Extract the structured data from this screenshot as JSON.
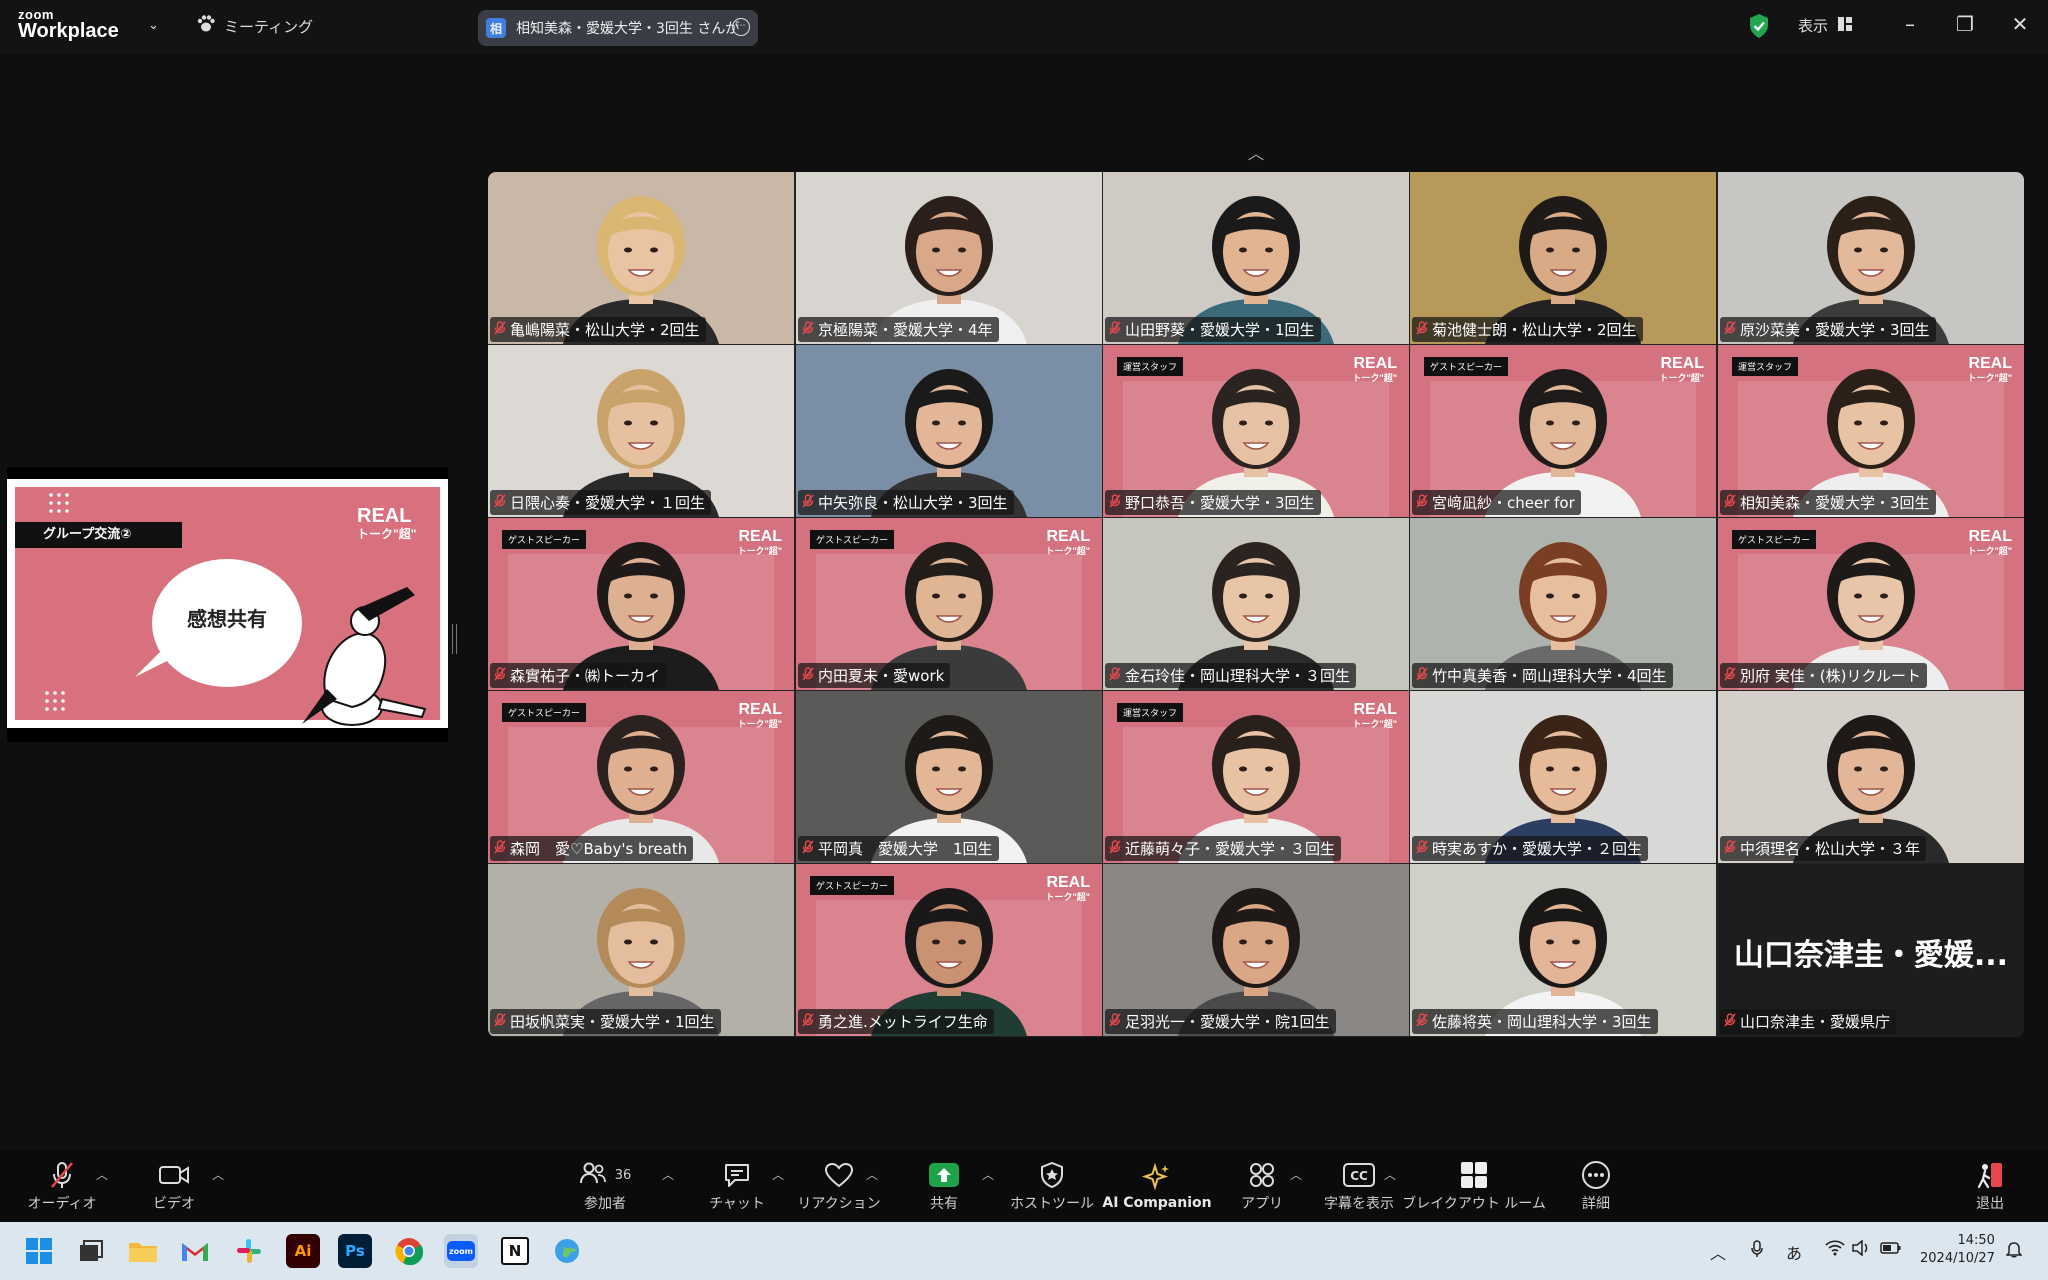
{
  "titlebar": {
    "logo_small": "zoom",
    "logo_big": "Workplace",
    "meeting_label": "ミーティング",
    "speaker_initial": "相",
    "speaker_name": "相知美森・愛媛大学・3回生 さんが",
    "view_label": "表示"
  },
  "shared_screen": {
    "tag": "グループ交流②",
    "brand": "REAL",
    "brand_sub": "トーク\"超\"",
    "bubble": "感想共有"
  },
  "tiles": [
    {
      "name": "亀嶋陽菜・松山大学・2回生",
      "bg": "#c9b8a8",
      "skin": "#e8c4a2",
      "hair": "#d9b772",
      "shirt": "#2a2a2a"
    },
    {
      "name": "京極陽菜・愛媛大学・4年",
      "bg": "#d8d4cf",
      "skin": "#d9a888",
      "hair": "#2a1f1a",
      "shirt": "#efefef"
    },
    {
      "name": "山田野葵・愛媛大学・1回生",
      "bg": "#cfcac4",
      "skin": "#e2b592",
      "hair": "#1a1a1a",
      "shirt": "#3b6b7a"
    },
    {
      "name": "菊池健士朗・松山大学・2回生",
      "bg": "#b79a5a",
      "skin": "#d8aa86",
      "hair": "#1e1a18",
      "shirt": "#222"
    },
    {
      "name": "原沙菜美・愛媛大学・3回生",
      "bg": "#c8c6c2",
      "skin": "#e3b99a",
      "hair": "#2a2018",
      "shirt": "#3c3c3c"
    },
    {
      "name": "日隈心奏・愛媛大学・１回生",
      "bg": "#dcd8d3",
      "skin": "#e7c0a0",
      "hair": "#c9a36a",
      "shirt": "#2a2a2a"
    },
    {
      "name": "中矢弥良・松山大学・3回生",
      "bg": "#7a8fa6",
      "skin": "#e2b696",
      "hair": "#1a1a1a",
      "shirt": "#333"
    },
    {
      "name": "野口恭吾・愛媛大学・3回生",
      "bg": "#d4737f",
      "skin": "#e6c1a3",
      "hair": "#2a2320",
      "shirt": "#f0efe8",
      "badge": "運営スタッフ",
      "real": true
    },
    {
      "name": "宮﨑凪紗・cheer for",
      "bg": "#d4737f",
      "skin": "#e2b998",
      "hair": "#1f1b1a",
      "shirt": "#f2f2f2",
      "badge": "ゲストスピーカー",
      "real": true
    },
    {
      "name": "相知美森・愛媛大学・3回生",
      "bg": "#d4737f",
      "skin": "#e7c3a4",
      "hair": "#2a2018",
      "shirt": "#eee",
      "badge": "運営スタッフ",
      "real": true
    },
    {
      "name": "森實祐子・㈱トーカイ",
      "bg": "#d4737f",
      "skin": "#dcb090",
      "hair": "#1f1a18",
      "shirt": "#1c1c1c",
      "badge": "ゲストスピーカー",
      "real": true
    },
    {
      "name": "内田夏未・愛work",
      "bg": "#d4737f",
      "skin": "#e0b594",
      "hair": "#231d1a",
      "shirt": "#3b3b3b",
      "badge": "ゲストスピーカー",
      "real": true
    },
    {
      "name": "金石玲佳・岡山理科大学・３回生",
      "bg": "#c7c6bd",
      "skin": "#e7c5a6",
      "hair": "#2a231f",
      "shirt": "#2c2c2c"
    },
    {
      "name": "竹中真美香・岡山理科大学・4回生",
      "bg": "#aeb4ad",
      "skin": "#e8bf9e",
      "hair": "#7a3f22",
      "shirt": "#6a6a6a"
    },
    {
      "name": "別府 実佳・(株)リクルート",
      "bg": "#d4737f",
      "skin": "#e8c5a8",
      "hair": "#1e1a18",
      "shirt": "#eee",
      "badge": "ゲストスピーカー",
      "real": true
    },
    {
      "name": "森岡　愛♡Baby's breath",
      "bg": "#d4737f",
      "skin": "#dfb090",
      "hair": "#2b2220",
      "shirt": "#e8e8e8",
      "badge": "ゲストスピーカー",
      "real": true
    },
    {
      "name": "平岡真　愛媛大学　1回生",
      "bg": "#5a5a58",
      "skin": "#e3b796",
      "hair": "#1e1a18",
      "shirt": "#f2f2f2"
    },
    {
      "name": "近藤萌々子・愛媛大学・３回生",
      "bg": "#d4737f",
      "skin": "#e8c2a3",
      "hair": "#2a201b",
      "shirt": "#f0f0f0",
      "badge": "運営スタッフ",
      "real": true
    },
    {
      "name": "時実あすか・愛媛大学・２回生",
      "bg": "#d8d8d6",
      "skin": "#e5bb9a",
      "hair": "#3a2418",
      "shirt": "#2d3e63"
    },
    {
      "name": "中須理名・松山大学・３年",
      "bg": "#d4cfc8",
      "skin": "#e2b697",
      "hair": "#1f1a18",
      "shirt": "#2a2a2a"
    },
    {
      "name": "田坂帆菜実・愛媛大学・1回生",
      "bg": "#b3b0a8",
      "skin": "#e4bd9c",
      "hair": "#b48a5a",
      "shirt": "#666"
    },
    {
      "name": "勇之進.メットライフ生命",
      "bg": "#d4737f",
      "skin": "#c99373",
      "hair": "#1a1818",
      "shirt": "#1f3d33",
      "badge": "ゲストスピーカー",
      "real": true
    },
    {
      "name": "足羽光一・愛媛大学・院1回生",
      "bg": "#8a8784",
      "skin": "#d9a786",
      "hair": "#1f1a18",
      "shirt": "#4a4a4a"
    },
    {
      "name": "佐藤将英・岡山理科大学・3回生",
      "bg": "#cfd1c8",
      "skin": "#e2b596",
      "hair": "#1a1816",
      "shirt": "#f4f4f4"
    },
    {
      "name": "山口奈津圭・愛媛県庁",
      "bg": "#1d1d1f",
      "camera_off": true,
      "big_text": "山口奈津圭・愛媛..."
    }
  ],
  "toolbar": {
    "audio": "オーディオ",
    "video": "ビデオ",
    "participants": "参加者",
    "participants_count": "36",
    "chat": "チャット",
    "reactions": "リアクション",
    "share": "共有",
    "host_tools": "ホストツール",
    "ai_companion": "AI Companion",
    "apps": "アプリ",
    "captions": "字幕を表示",
    "breakout": "ブレイクアウト ルーム",
    "more": "詳細",
    "leave": "退出"
  },
  "taskbar": {
    "apps": [
      "Ai",
      "Ps",
      "zoom",
      "N"
    ],
    "ime": "あ",
    "time": "14:50",
    "date": "2024/10/27"
  },
  "colors": {
    "accent_pink": "#d4737f",
    "share_green": "#1fa34a",
    "mute_red": "#e5484d",
    "ai_gold": "#f0c14b"
  }
}
